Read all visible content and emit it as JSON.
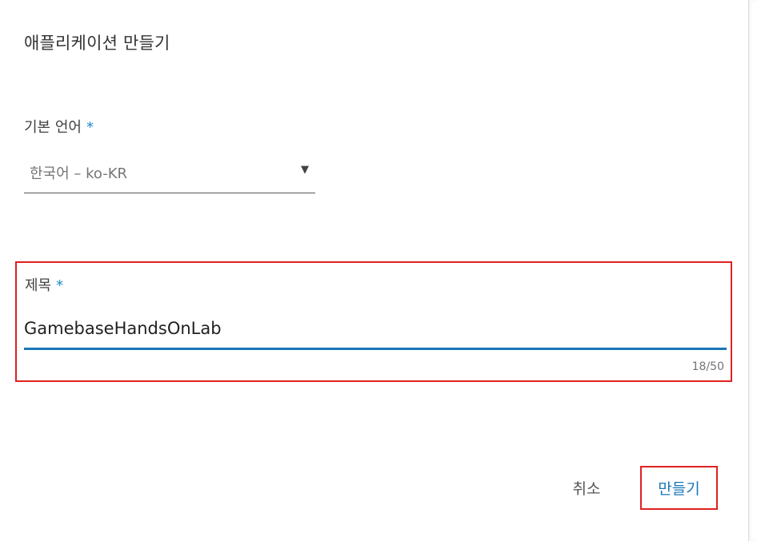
{
  "dialog": {
    "title": "애플리케이션 만들기"
  },
  "language_field": {
    "label": "기본 언어",
    "required_mark": "*",
    "selected_value": "한국어 – ko-KR",
    "arrow_glyph": "▼"
  },
  "title_field": {
    "label": "제목",
    "required_mark": "*",
    "value": "GamebaseHandsOnLab",
    "counter": "18/50"
  },
  "actions": {
    "cancel_label": "취소",
    "create_label": "만들기"
  },
  "colors": {
    "accent": "#1976b8",
    "highlight_border": "#e02020"
  }
}
